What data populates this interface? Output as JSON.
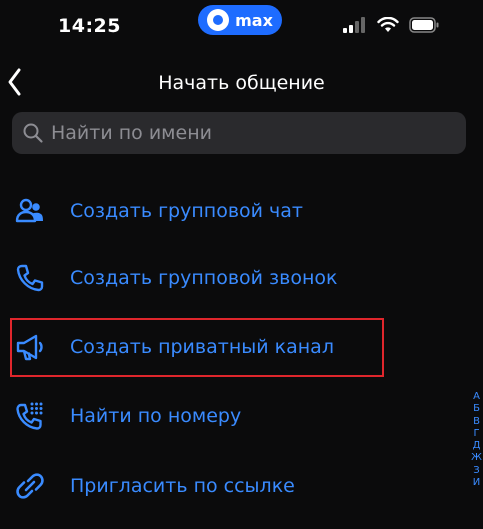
{
  "status": {
    "time": "14:25",
    "app_pill": "max"
  },
  "header": {
    "title": "Начать общение"
  },
  "search": {
    "placeholder": "Найти по имени"
  },
  "actions": [
    {
      "label": "Создать групповой чат",
      "icon": "group-icon"
    },
    {
      "label": "Создать групповой звонок",
      "icon": "phone-icon"
    },
    {
      "label": "Создать приватный канал",
      "icon": "megaphone-icon"
    },
    {
      "label": "Найти по номеру",
      "icon": "dialpad-phone-icon"
    },
    {
      "label": "Пригласить по ссылке",
      "icon": "link-icon"
    }
  ],
  "alphabet": [
    "А",
    "Б",
    "В",
    "Г",
    "Д",
    "Ж",
    "З",
    "И"
  ],
  "colors": {
    "accent": "#3a8bff",
    "highlight": "#e0262c",
    "background": "#0b0b0c"
  }
}
